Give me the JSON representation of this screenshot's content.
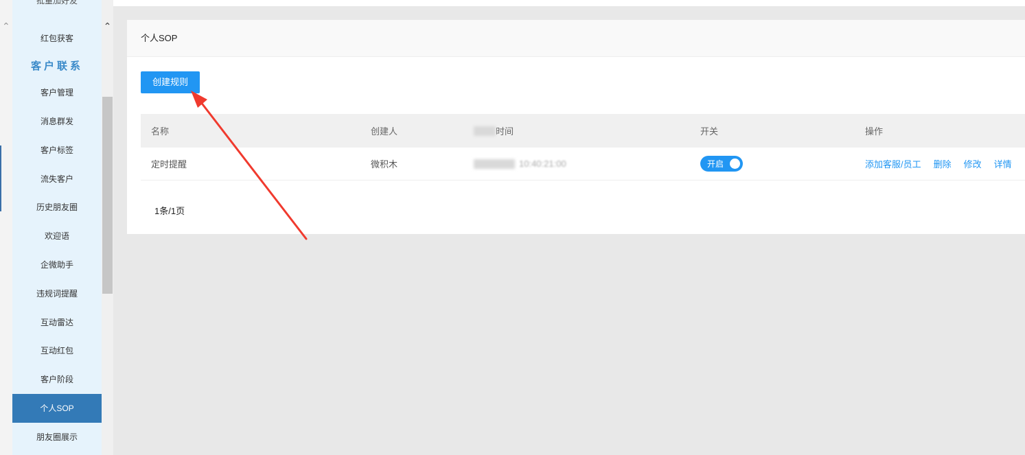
{
  "sidebar": {
    "cut_item": "批量加好友",
    "items": [
      {
        "label": "红包获客"
      },
      {
        "label": "客户管理"
      },
      {
        "label": "消息群发"
      },
      {
        "label": "客户标签"
      },
      {
        "label": "流失客户"
      },
      {
        "label": "历史朋友圈"
      },
      {
        "label": "欢迎语"
      },
      {
        "label": "企微助手"
      },
      {
        "label": "违规词提醒"
      },
      {
        "label": "互动雷达"
      },
      {
        "label": "互动红包"
      },
      {
        "label": "客户阶段"
      },
      {
        "label": "个人SOP",
        "active": true
      },
      {
        "label": "朋友圈展示"
      }
    ],
    "section_title": "客户联系"
  },
  "panel": {
    "title": "个人SOP",
    "create_button": "创建规则"
  },
  "table": {
    "headers": [
      "名称",
      "创建人",
      "时间",
      "开关",
      "操作"
    ],
    "rows": [
      {
        "name": "定时提醒",
        "creator": "微积木",
        "time": "10:40:21:00",
        "switch_label": "开启",
        "switch_on": true,
        "actions": [
          "添加客服/员工",
          "删除",
          "修改",
          "详情"
        ]
      }
    ]
  },
  "pagination": "1条/1页",
  "colors": {
    "accent": "#2196f3",
    "active_nav": "#337ab7",
    "sidebar_bg": "#e6f3fc",
    "section_title": "#3a8ac9",
    "annotation_arrow": "#f03a2e"
  },
  "icons": {
    "left_rail_chevron": "chevron-up-icon",
    "scroll_up": "chevron-up-icon"
  }
}
